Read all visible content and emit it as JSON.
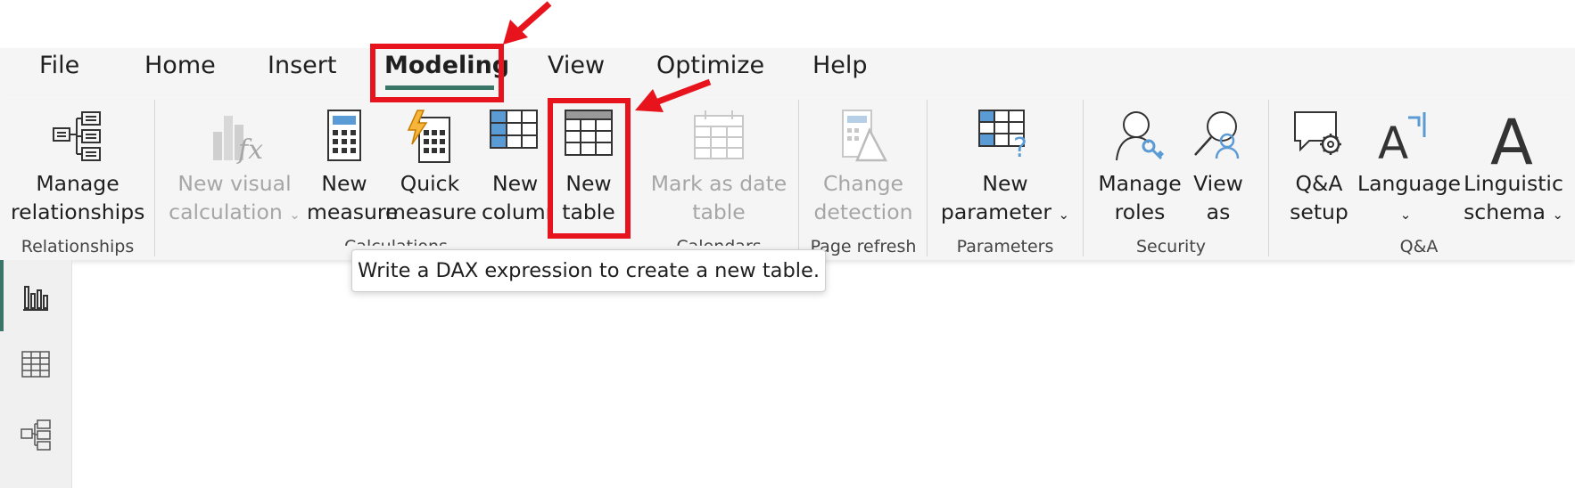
{
  "tabs": [
    "File",
    "Home",
    "Insert",
    "Modeling",
    "View",
    "Optimize",
    "Help"
  ],
  "active_tab": "Modeling",
  "ribbon": {
    "manage_relationships": [
      "Manage",
      "relationships"
    ],
    "new_visual_calculation": [
      "New visual",
      "calculation"
    ],
    "new_measure": [
      "New",
      "measure"
    ],
    "quick_measure": [
      "Quick",
      "measure"
    ],
    "new_column": [
      "New",
      "column"
    ],
    "new_table": [
      "New",
      "table"
    ],
    "mark_as_date_table": [
      "Mark as date",
      "table"
    ],
    "change_detection": [
      "Change",
      "detection"
    ],
    "new_parameter": [
      "New",
      "parameter"
    ],
    "manage_roles": [
      "Manage",
      "roles"
    ],
    "view_as": [
      "View",
      "as"
    ],
    "qa_setup": [
      "Q&A",
      "setup"
    ],
    "language": [
      "Language",
      ""
    ],
    "linguistic_schema": [
      "Linguistic",
      "schema"
    ]
  },
  "groups": {
    "relationships": "Relationships",
    "calculations": "Calculations",
    "calendars": "Calendars",
    "page_refresh": "Page refresh",
    "parameters": "Parameters",
    "security": "Security",
    "qa": "Q&A"
  },
  "tooltip": "Write a DAX expression to create a new table.",
  "sidebar": [
    "report-view-icon",
    "table-view-icon",
    "model-view-icon"
  ],
  "colors": {
    "accent": "#3a7668",
    "highlight": "#e8141d",
    "disabled": "#a6a6a6"
  }
}
